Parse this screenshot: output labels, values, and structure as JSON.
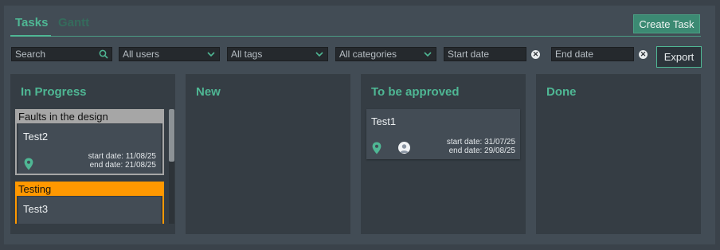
{
  "tabs": [
    {
      "label": "Tasks",
      "active": true
    },
    {
      "label": "Gantt",
      "active": false
    }
  ],
  "toolbar": {
    "create_label": "Create Task",
    "export_label": "Export"
  },
  "filters": {
    "search_placeholder": "Search",
    "users": "All users",
    "tags": "All tags",
    "categories": "All categories",
    "start_date_placeholder": "Start date",
    "end_date_placeholder": "End date"
  },
  "columns": [
    {
      "title": "In Progress"
    },
    {
      "title": "New"
    },
    {
      "title": "To be approved"
    },
    {
      "title": "Done"
    }
  ],
  "in_progress": {
    "groups": [
      {
        "name": "Faults in the design",
        "color": "#a6a6a6",
        "card": {
          "title": "Test2",
          "start": "start date: 11/08/25",
          "end": "end date: 21/08/25"
        }
      },
      {
        "name": "Testing",
        "color": "#ff9800",
        "card": {
          "title": "Test3"
        }
      }
    ]
  },
  "to_be_approved": {
    "card": {
      "title": "Test1",
      "start": "start date: 31/07/25",
      "end": "end date: 29/08/25"
    }
  },
  "colors": {
    "accent": "#4fb794",
    "background": "#3a424a",
    "column": "#353d44",
    "card": "#434c55"
  },
  "icons": {
    "search": "search-icon",
    "dropdown": "chevron-down-icon",
    "clear": "close-icon",
    "location": "location-pin-icon",
    "user": "user-avatar-icon"
  }
}
